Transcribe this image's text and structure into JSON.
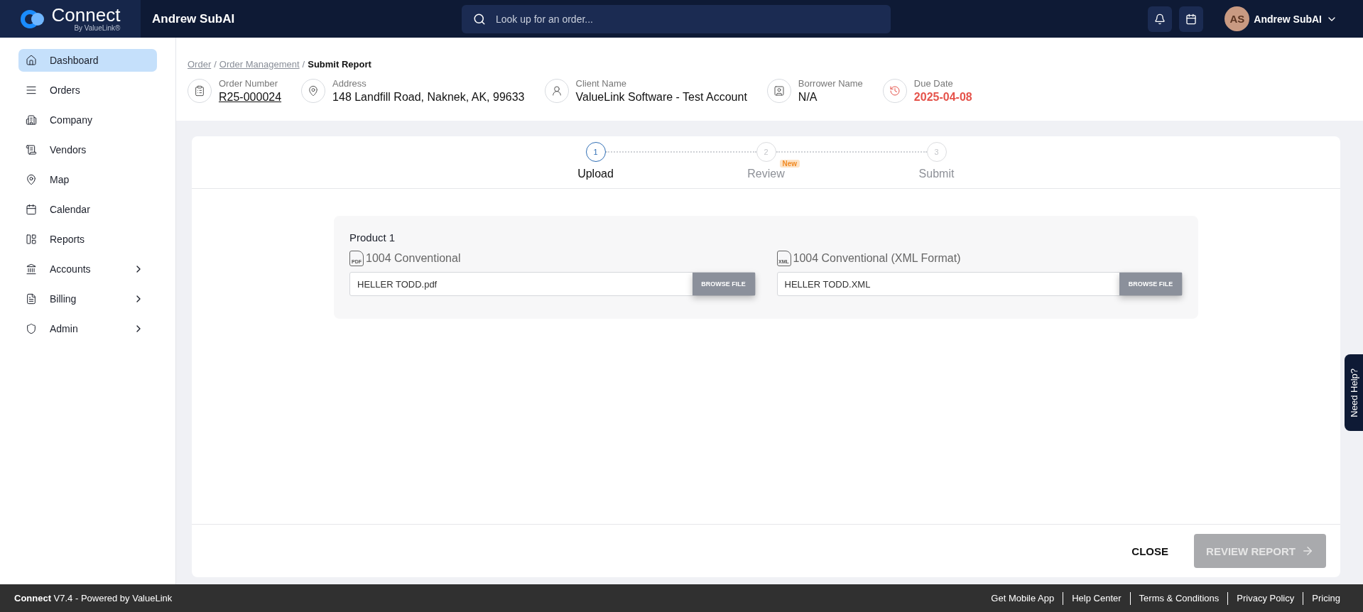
{
  "topbar": {
    "logo_title": "Connect",
    "logo_subtitle": "By ValueLink®",
    "company": "Andrew SubAI",
    "search": {
      "placeholder": "Look up for an order..."
    },
    "user": {
      "initials": "AS",
      "name": "Andrew SubAI"
    }
  },
  "sidebar": {
    "items": [
      {
        "label": "Dashboard",
        "selected": true,
        "has_submenu": false
      },
      {
        "label": "Orders",
        "selected": false,
        "has_submenu": false
      },
      {
        "label": "Company",
        "selected": false,
        "has_submenu": false
      },
      {
        "label": "Vendors",
        "selected": false,
        "has_submenu": false
      },
      {
        "label": "Map",
        "selected": false,
        "has_submenu": false
      },
      {
        "label": "Calendar",
        "selected": false,
        "has_submenu": false
      },
      {
        "label": "Reports",
        "selected": false,
        "has_submenu": false
      },
      {
        "label": "Accounts",
        "selected": false,
        "has_submenu": true
      },
      {
        "label": "Billing",
        "selected": false,
        "has_submenu": true
      },
      {
        "label": "Admin",
        "selected": false,
        "has_submenu": true
      }
    ]
  },
  "breadcrumb": [
    {
      "label": "Order",
      "link": true
    },
    {
      "separator": "/",
      "label": "Order Management",
      "link": true
    },
    {
      "separator": "/",
      "label": "Submit Report",
      "link": false
    }
  ],
  "order_info": [
    {
      "label": "Order Number",
      "value": "R25-000024",
      "kind": "link"
    },
    {
      "label": "Address",
      "value": "148 Landfill Road, Naknek, AK, 99633",
      "kind": "text"
    },
    {
      "label": "Client Name",
      "value": "ValueLink Software - Test Account",
      "kind": "text"
    },
    {
      "label": "Borrower Name",
      "value": "N/A",
      "kind": "text"
    },
    {
      "label": "Due Date",
      "value": "2025-04-08",
      "kind": "alert"
    }
  ],
  "steps": [
    {
      "number": "1",
      "label": "Upload",
      "selected": true
    },
    {
      "number": "2",
      "label": "Review",
      "selected": false,
      "badge": "New"
    },
    {
      "number": "3",
      "label": "Submit",
      "selected": false
    }
  ],
  "product": {
    "title": "Product 1",
    "uploads": [
      {
        "format": "PDF",
        "label": "1004 Conventional",
        "value": "HELLER TODD.pdf",
        "button": "BROWSE FILE"
      },
      {
        "format": "XML",
        "label": "1004 Conventional (XML Format)",
        "value": "HELLER TODD.XML",
        "button": "BROWSE FILE"
      }
    ]
  },
  "actions": {
    "close": "CLOSE",
    "primary": {
      "label": "REVIEW REPORT",
      "disabled": true
    }
  },
  "help_tab": "Need Help?",
  "footer": {
    "brand": "Connect",
    "version": " V7.4 - Powered by ValueLink",
    "links": [
      "Get Mobile App",
      "Help Center",
      "Terms & Conditions",
      "Privacy Policy",
      "Pricing"
    ]
  }
}
